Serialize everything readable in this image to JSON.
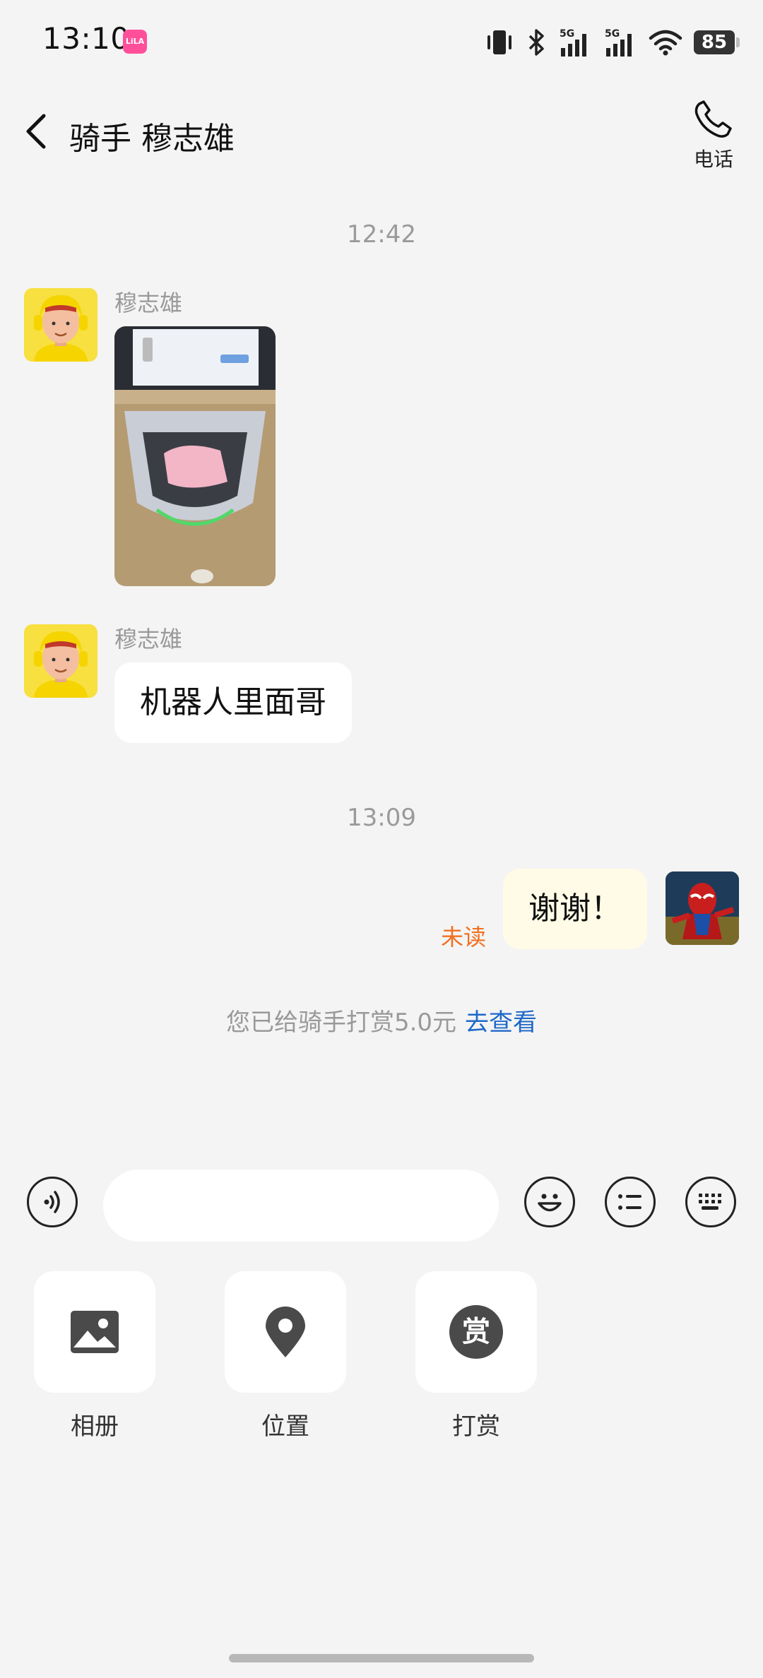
{
  "status": {
    "time": "13:10",
    "app_badge": "LiLA",
    "battery": "85"
  },
  "header": {
    "title": "骑手 穆志雄",
    "call_label": "电话"
  },
  "chat": {
    "time_1": "12:42",
    "time_2": "13:09",
    "msg1_sender": "穆志雄",
    "msg2_sender": "穆志雄",
    "msg2_text": "机器人里面哥",
    "msg3_text": "谢谢！",
    "msg3_status": "未读",
    "tip_text": "您已给骑手打赏5.0元",
    "tip_link": "去查看"
  },
  "input": {
    "placeholder": ""
  },
  "tools": [
    {
      "label": "相册",
      "icon": "photo-album-icon"
    },
    {
      "label": "位置",
      "icon": "location-pin-icon"
    },
    {
      "label": "打赏",
      "icon": "reward-icon",
      "glyph": "赏"
    }
  ],
  "colors": {
    "background": "#f4f4f4",
    "bubble_out": "#fffbe6",
    "unread": "#f07020",
    "link": "#1e68c8"
  }
}
